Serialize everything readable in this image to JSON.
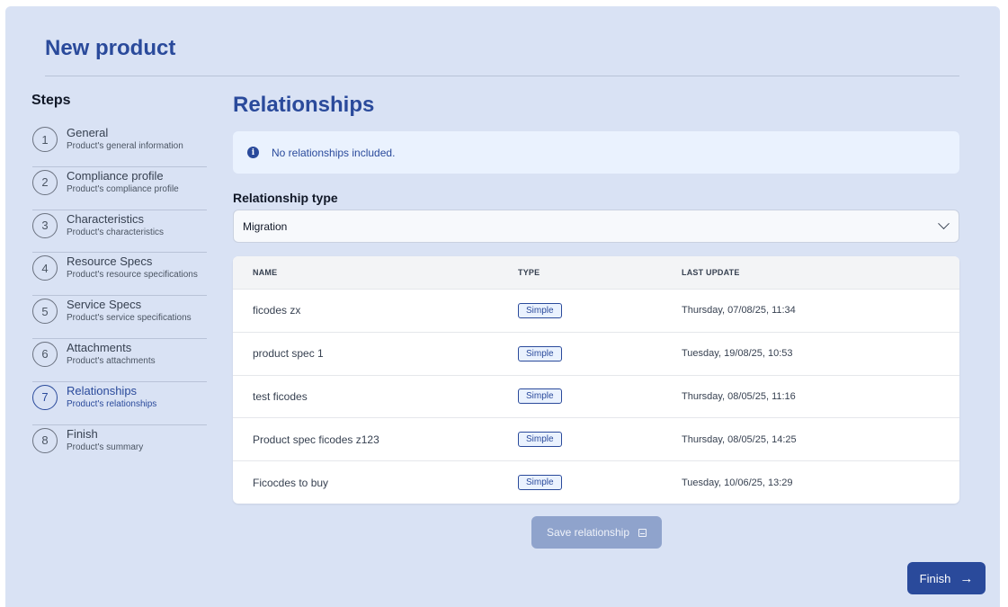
{
  "page": {
    "title": "New product"
  },
  "steps": {
    "heading": "Steps",
    "items": [
      {
        "num": "1",
        "title": "General",
        "subtitle": "Product's general information"
      },
      {
        "num": "2",
        "title": "Compliance profile",
        "subtitle": "Product's compliance profile"
      },
      {
        "num": "3",
        "title": "Characteristics",
        "subtitle": "Product's characteristics"
      },
      {
        "num": "4",
        "title": "Resource Specs",
        "subtitle": "Product's resource specifications"
      },
      {
        "num": "5",
        "title": "Service Specs",
        "subtitle": "Product's service specifications"
      },
      {
        "num": "6",
        "title": "Attachments",
        "subtitle": "Product's attachments"
      },
      {
        "num": "7",
        "title": "Relationships",
        "subtitle": "Product's relationships"
      },
      {
        "num": "8",
        "title": "Finish",
        "subtitle": "Product's summary"
      }
    ],
    "active_index": 6
  },
  "main": {
    "title": "Relationships",
    "info": {
      "icon": "info-icon",
      "text": "No relationships included."
    },
    "relationship_type": {
      "label": "Relationship type",
      "value": "Migration"
    },
    "table": {
      "headers": {
        "name": "NAME",
        "type": "TYPE",
        "last_update": "LAST UPDATE"
      },
      "rows": [
        {
          "name": "ficodes zx",
          "type": "Simple",
          "last_update": "Thursday, 07/08/25, 11:34"
        },
        {
          "name": "product spec 1",
          "type": "Simple",
          "last_update": "Tuesday, 19/08/25, 10:53"
        },
        {
          "name": "test ficodes",
          "type": "Simple",
          "last_update": "Thursday, 08/05/25, 11:16"
        },
        {
          "name": "Product spec ficodes z123",
          "type": "Simple",
          "last_update": "Thursday, 08/05/25, 14:25"
        },
        {
          "name": "Ficocdes to buy",
          "type": "Simple",
          "last_update": "Tuesday, 10/06/25, 13:29"
        }
      ]
    },
    "save_button": {
      "label": "Save relationship",
      "icon": "save-icon"
    },
    "finish_button": {
      "label": "Finish",
      "icon": "arrow-right-icon"
    }
  }
}
